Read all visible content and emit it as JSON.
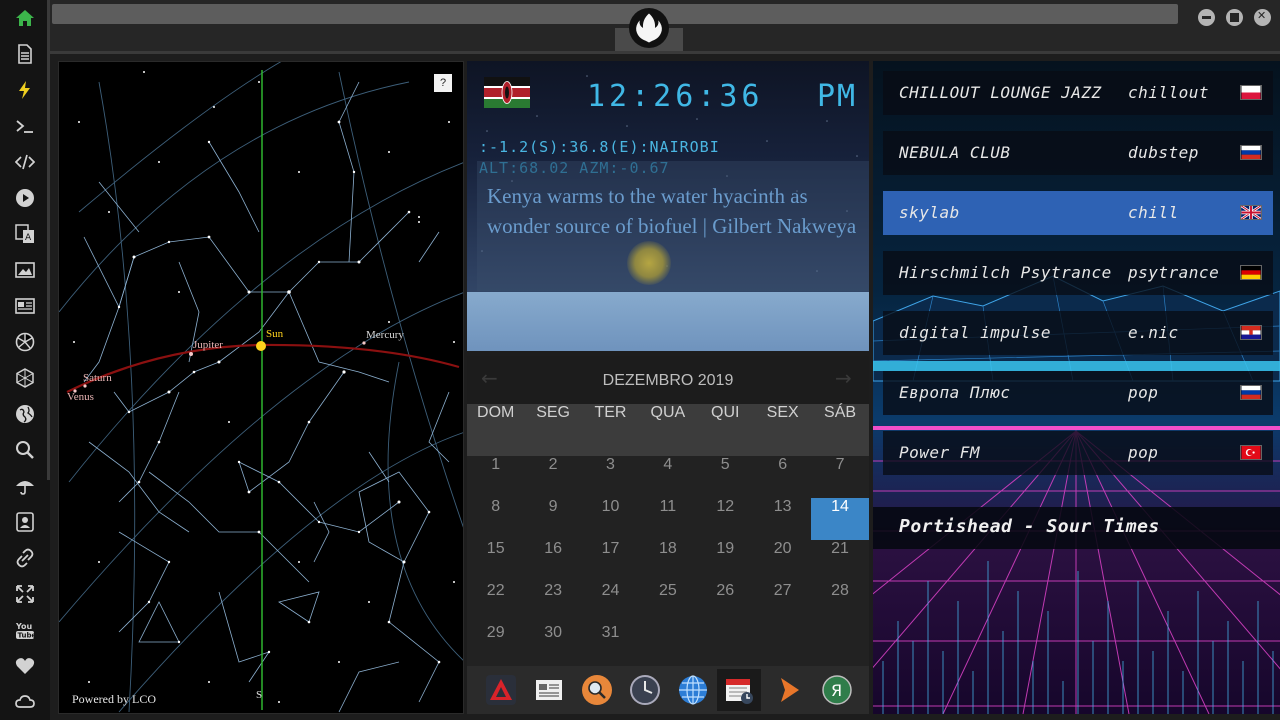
{
  "sidebar": {
    "items": [
      {
        "icon": "home-icon",
        "color": "#3cb44b"
      },
      {
        "icon": "document-icon"
      },
      {
        "icon": "lightning-icon",
        "color": "#f0d020"
      },
      {
        "icon": "terminal-icon"
      },
      {
        "icon": "code-icon"
      },
      {
        "icon": "play-icon"
      },
      {
        "icon": "translate-icon"
      },
      {
        "icon": "image-icon"
      },
      {
        "icon": "newspaper-icon"
      },
      {
        "icon": "aperture-icon"
      },
      {
        "icon": "hexagon-icon"
      },
      {
        "icon": "globe-icon"
      },
      {
        "icon": "search-icon"
      },
      {
        "icon": "umbrella-icon"
      },
      {
        "icon": "contact-icon"
      },
      {
        "icon": "link-icon"
      },
      {
        "icon": "expand-icon"
      },
      {
        "icon": "youtube-icon",
        "label": "You Tube"
      },
      {
        "icon": "heart-icon"
      },
      {
        "icon": "cloud-icon"
      }
    ]
  },
  "skymap": {
    "help_label": "?",
    "powered_by": "Powered by LCO",
    "south_label": "S",
    "planets": [
      "Sun",
      "Jupiter",
      "Mercury",
      "Saturn",
      "Venus"
    ]
  },
  "clock": {
    "flag": "kenya-flag-icon",
    "time": "12:26:36",
    "ampm": "PM",
    "location": ":-1.2(S):36.8(E):NAIROBI",
    "alt_azm": "ALT:68.02 AZM:-0.67",
    "news": "Kenya warms to the water hyacinth as wonder source of biofuel | Gilbert Nakweya"
  },
  "calendar": {
    "title": "DEZEMBRO 2019",
    "prev": "←",
    "next": "→",
    "weekdays": [
      "DOM",
      "SEG",
      "TER",
      "QUA",
      "QUI",
      "SEX",
      "SÁB"
    ],
    "weeks": [
      [
        "1",
        "2",
        "3",
        "4",
        "5",
        "6",
        "7"
      ],
      [
        "8",
        "9",
        "10",
        "11",
        "12",
        "13",
        "14"
      ],
      [
        "15",
        "16",
        "17",
        "18",
        "19",
        "20",
        "21"
      ],
      [
        "22",
        "23",
        "24",
        "25",
        "26",
        "27",
        "28"
      ],
      [
        "29",
        "30",
        "31",
        "",
        "",
        "",
        ""
      ]
    ],
    "today": "14",
    "today_color": "#3b86c7"
  },
  "dock": {
    "items": [
      "warning-app-icon",
      "news-app-icon",
      "search-app-icon",
      "clock-app-icon",
      "globe-app-icon",
      "calendar-app-icon",
      "play-app-icon",
      "yandex-app-icon"
    ]
  },
  "radio": {
    "stations": [
      {
        "name": "CHILLOUT LOUNGE JAZZ",
        "genre": "chillout",
        "flag": "poland-flag"
      },
      {
        "name": "NEBULA CLUB",
        "genre": "dubstep",
        "flag": "russia-flag"
      },
      {
        "name": "skylab",
        "genre": "chill",
        "flag": "uk-flag",
        "selected": true
      },
      {
        "name": "Hirschmilch Psytrance",
        "genre": "psytrance",
        "flag": "germany-flag"
      },
      {
        "name": "digital impulse",
        "genre": "e.nic",
        "flag": "croatia-flag"
      },
      {
        "name": "Европа Плюс",
        "genre": "pop",
        "flag": "russia-flag"
      },
      {
        "name": "Power FM",
        "genre": "pop",
        "flag": "turkey-flag"
      }
    ],
    "now_playing": "Portishead - Sour Times",
    "selected_color": "#2e62b4"
  }
}
